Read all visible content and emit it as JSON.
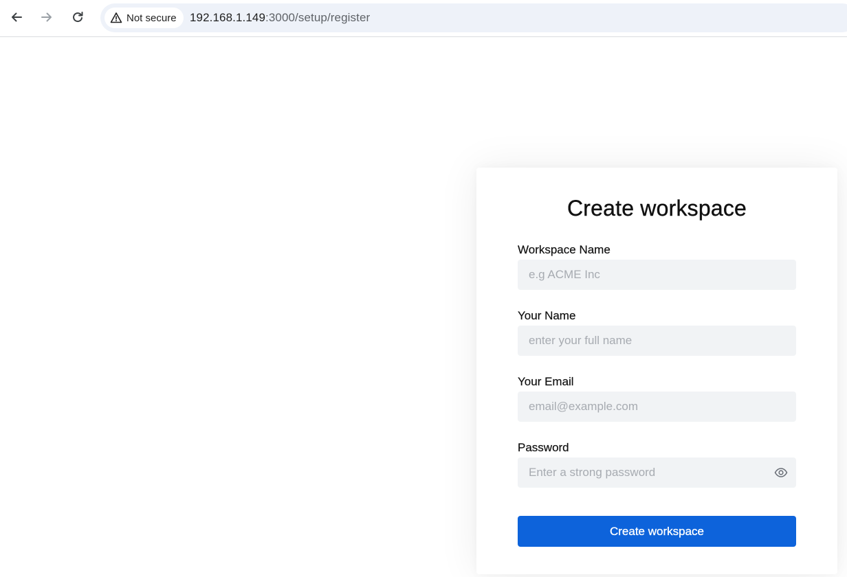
{
  "browser": {
    "security_label": "Not secure",
    "url_host": "192.168.1.149",
    "url_path": ":3000/setup/register",
    "icons": {
      "back": "back-arrow-icon",
      "forward": "forward-arrow-icon",
      "reload": "reload-icon",
      "warning": "warning-triangle-icon"
    }
  },
  "form": {
    "title": "Create workspace",
    "fields": {
      "workspace_name": {
        "label": "Workspace Name",
        "placeholder": "e.g ACME Inc",
        "value": ""
      },
      "your_name": {
        "label": "Your Name",
        "placeholder": "enter your full name",
        "value": ""
      },
      "email": {
        "label": "Your Email",
        "placeholder": "email@example.com",
        "value": ""
      },
      "password": {
        "label": "Password",
        "placeholder": "Enter a strong password",
        "value": "",
        "toggle_icon": "eye-icon"
      }
    },
    "submit_label": "Create workspace"
  },
  "colors": {
    "primary": "#0d63db",
    "input_bg": "#f1f3f5",
    "omnibox_bg": "#eef2f9",
    "placeholder": "#a7abb1"
  }
}
